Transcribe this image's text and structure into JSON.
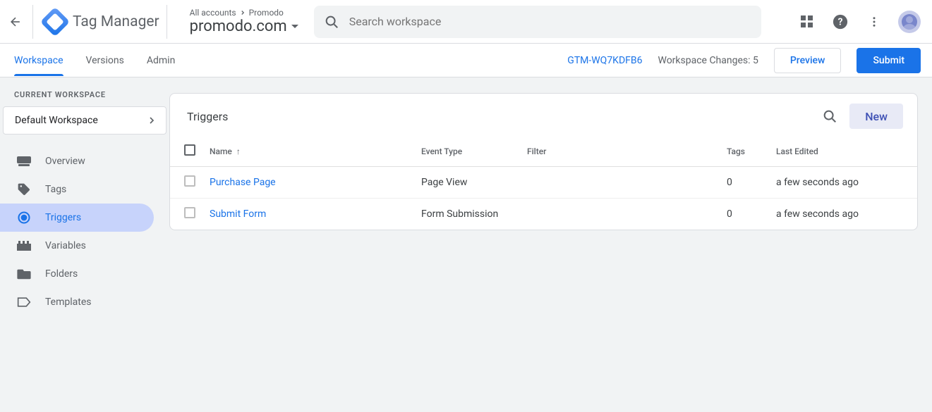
{
  "header": {
    "product_name": "Tag Manager",
    "breadcrumb_all": "All accounts",
    "breadcrumb_account": "Promodo",
    "container_name": "promodo.com",
    "search_placeholder": "Search workspace"
  },
  "subheader": {
    "tabs": {
      "workspace": "Workspace",
      "versions": "Versions",
      "admin": "Admin"
    },
    "container_id": "GTM-WQ7KDFB6",
    "changes_label": "Workspace Changes: 5",
    "preview": "Preview",
    "submit": "Submit"
  },
  "sidebar": {
    "current_label": "CURRENT WORKSPACE",
    "workspace_name": "Default Workspace",
    "items": {
      "overview": "Overview",
      "tags": "Tags",
      "triggers": "Triggers",
      "variables": "Variables",
      "folders": "Folders",
      "templates": "Templates"
    }
  },
  "main": {
    "title": "Triggers",
    "new_label": "New",
    "columns": {
      "name": "Name",
      "event": "Event Type",
      "filter": "Filter",
      "tags": "Tags",
      "edited": "Last Edited"
    },
    "rows": [
      {
        "name": "Purchase Page",
        "event": "Page View",
        "filter": "",
        "tags": "0",
        "edited": "a few seconds ago"
      },
      {
        "name": "Submit Form",
        "event": "Form Submission",
        "filter": "",
        "tags": "0",
        "edited": "a few seconds ago"
      }
    ]
  }
}
